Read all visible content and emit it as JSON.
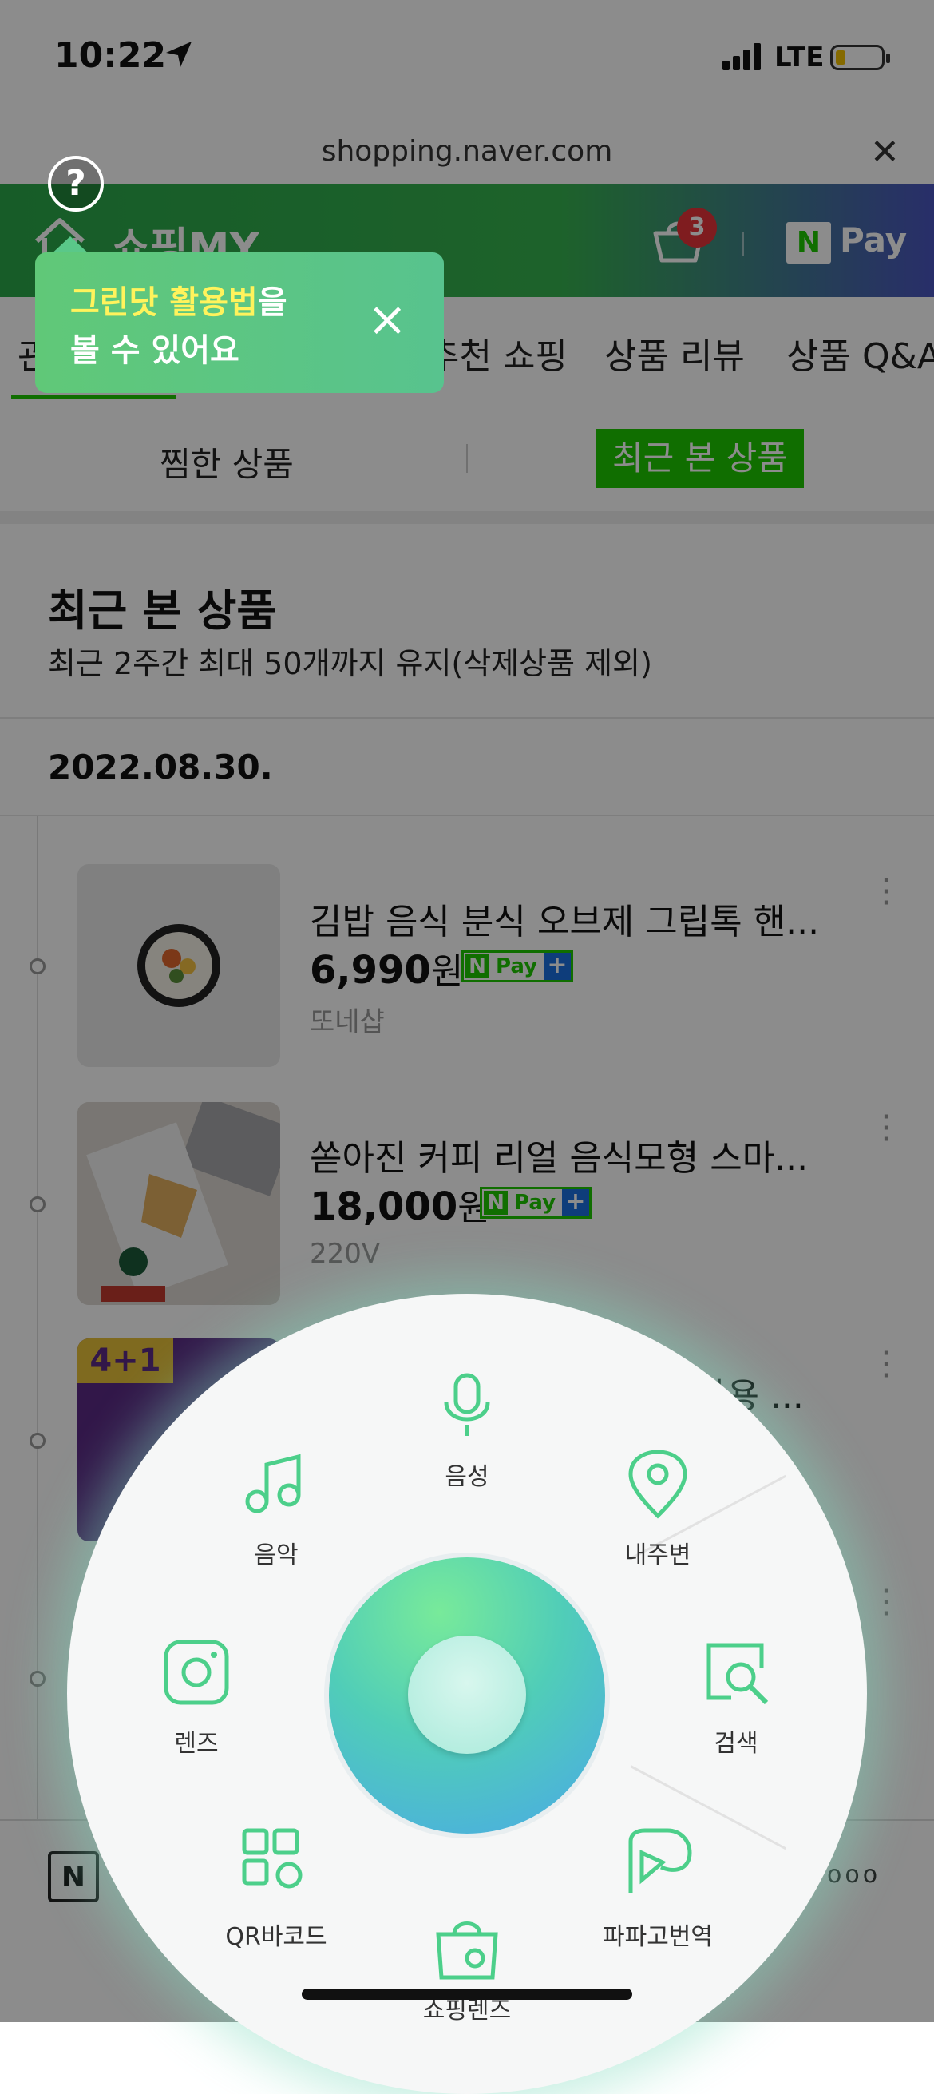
{
  "status_bar": {
    "time": "10:22",
    "network": "LTE"
  },
  "browser": {
    "url": "shopping.naver.com"
  },
  "header": {
    "title": "쇼핑MY",
    "cart_count": "3",
    "pay_badge": "N",
    "pay_label": "Pay"
  },
  "tabs": [
    "관",
    "추천 쇼핑",
    "상품 리뷰",
    "상품 Q&A"
  ],
  "subtabs": {
    "wishlist": "찜한 상품",
    "recent": "최근 본 상품"
  },
  "recent": {
    "title": "최근 본 상품",
    "subtitle": "최근 2주간 최대 50개까지 유지(삭제상품 제외)",
    "date": "2022.08.30."
  },
  "products": [
    {
      "name": "김밥 음식 분식 오브제 그립톡 핸...",
      "price": "6,990",
      "won": "원",
      "shop": "또네샵"
    },
    {
      "name": "쏟아진 커피 리얼 음식모형 스마...",
      "price": "18,000",
      "won": "원",
      "shop": "220V"
    },
    {
      "name_tail": "사용 ...",
      "thumb_badge": "4+1"
    }
  ],
  "npay": {
    "n": "N",
    "pay": "Pay",
    "plus": "+"
  },
  "bottom_nav": {
    "n_button": "N",
    "more": "ooo"
  },
  "tooltip": {
    "help": "?",
    "line1_highlight": "그린닷 활용법",
    "line1_rest": "을",
    "line2": "볼 수 있어요",
    "close": "×"
  },
  "wheel": {
    "voice": "음성",
    "music": "음악",
    "nearby": "내주변",
    "lens": "렌즈",
    "search": "검색",
    "qr": "QR바코드",
    "papago": "파파고번역",
    "shopping_lens": "쇼핑렌즈"
  },
  "colors": {
    "naver_green": "#1ec800",
    "badge_red": "#e8333a",
    "icon_green": "#4ccf8a"
  }
}
